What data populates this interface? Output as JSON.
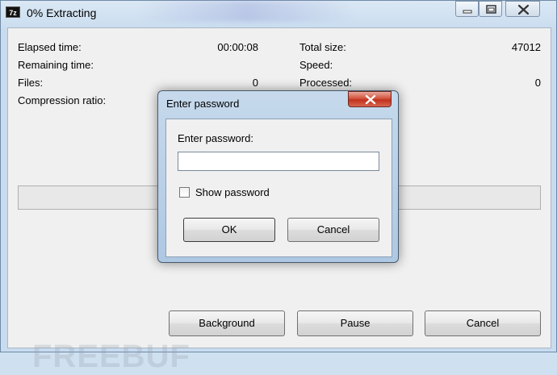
{
  "window": {
    "title": "0% Extracting",
    "app_icon_text": "7z"
  },
  "stats_left": [
    {
      "label": "Elapsed time:",
      "value": "00:00:08"
    },
    {
      "label": "Remaining time:",
      "value": ""
    },
    {
      "label": "Files:",
      "value": "0"
    },
    {
      "label": "Compression ratio:",
      "value": ""
    }
  ],
  "stats_right": [
    {
      "label": "Total size:",
      "value": "47012"
    },
    {
      "label": "Speed:",
      "value": ""
    },
    {
      "label": "Processed:",
      "value": "0"
    }
  ],
  "progress": {
    "fraction": 0.0
  },
  "buttons": {
    "background": "Background",
    "pause": "Pause",
    "cancel": "Cancel"
  },
  "watermark": "FREEBUF",
  "dialog": {
    "title": "Enter password",
    "prompt": "Enter password:",
    "password_value": "",
    "show_password_label": "Show password",
    "show_password_checked": false,
    "ok_label": "OK",
    "cancel_label": "Cancel"
  },
  "icons": {
    "minimize": "minimize-icon",
    "maximize": "restore-icon",
    "close": "close-icon"
  }
}
